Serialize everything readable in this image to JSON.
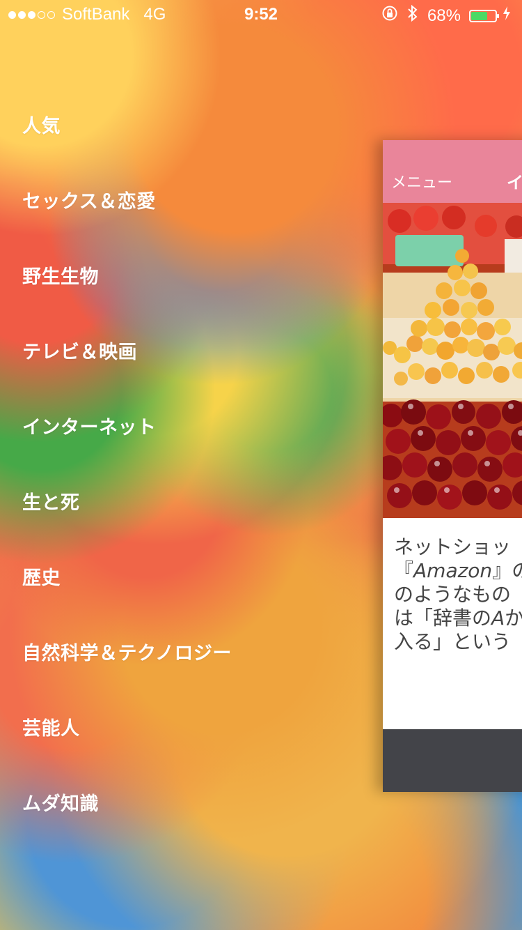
{
  "status_bar": {
    "carrier": "SoftBank",
    "network": "4G",
    "time": "9:52",
    "battery_percent": "68%",
    "battery_level": 0.68,
    "icons": [
      "signal-strength-icon",
      "orientation-lock-icon",
      "bluetooth-icon",
      "battery-icon",
      "charging-icon"
    ]
  },
  "menu": {
    "items": [
      {
        "label": "人気"
      },
      {
        "label": "セックス＆恋愛"
      },
      {
        "label": "野生生物"
      },
      {
        "label": "テレビ＆映画"
      },
      {
        "label": "インターネット"
      },
      {
        "label": "生と死"
      },
      {
        "label": "歴史"
      },
      {
        "label": "自然科学＆テクノロジー"
      },
      {
        "label": "芸能人"
      },
      {
        "label": "ムダ知識"
      }
    ]
  },
  "preview": {
    "header": {
      "menu_label": "メニュー",
      "title": "イ"
    },
    "text_lines": [
      {
        "text": "ネットショッ"
      },
      {
        "before": "『",
        "italic": "Amazon",
        "after": "』の"
      },
      {
        "text": "のようなもの"
      },
      {
        "before": "は「辞書の",
        "italic": "A",
        "after": "か"
      },
      {
        "text": "入る」という"
      }
    ]
  },
  "colors": {
    "header_pink": "#e9859a",
    "footer_dark": "#434449",
    "battery_green": "#4cd964",
    "text_gray": "#454545"
  }
}
